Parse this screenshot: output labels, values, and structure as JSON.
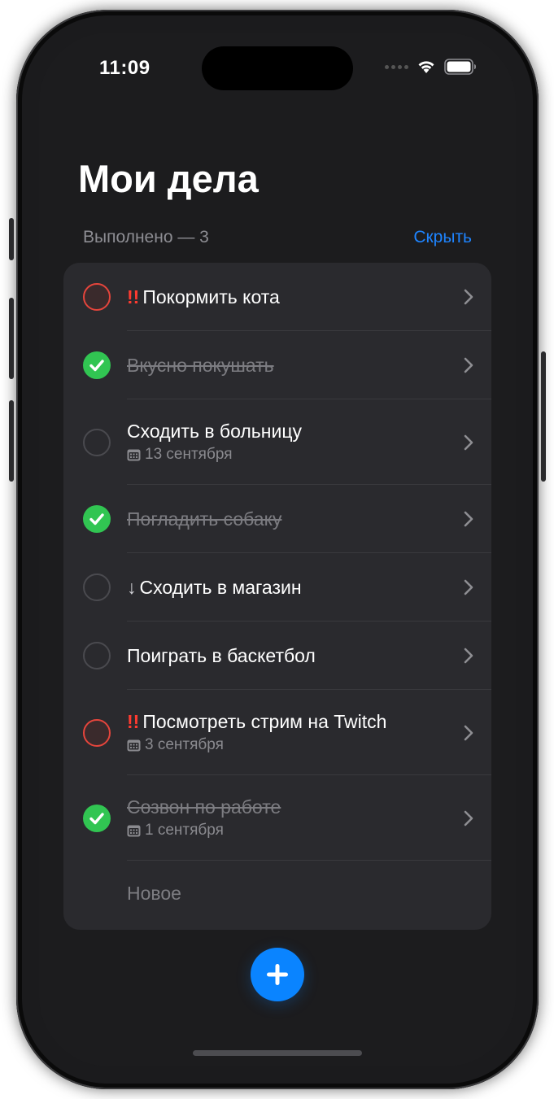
{
  "status_bar": {
    "time": "11:09"
  },
  "header": {
    "title": "Мои дела"
  },
  "summary": {
    "done_label": "Выполнено — 3",
    "hide_label": "Скрыть"
  },
  "tasks": [
    {
      "title": "Покормить кота",
      "prefix": "!!",
      "state": "urgent",
      "date": null
    },
    {
      "title": "Вкусно покушать",
      "prefix": null,
      "state": "done",
      "date": null
    },
    {
      "title": "Сходить в больницу",
      "prefix": null,
      "state": "open",
      "date": "13 сентября"
    },
    {
      "title": "Погладить собаку",
      "prefix": null,
      "state": "done",
      "date": null
    },
    {
      "title": "Сходить в магазин",
      "prefix": "↓",
      "state": "open",
      "date": null
    },
    {
      "title": "Поиграть в баскетбол",
      "prefix": null,
      "state": "open",
      "date": null
    },
    {
      "title": "Посмотреть стрим на Twitch",
      "prefix": "!!",
      "state": "urgent",
      "date": "3 сентября"
    },
    {
      "title": "Созвон по работе",
      "prefix": null,
      "state": "done",
      "date": "1 сентября"
    }
  ],
  "new_item": {
    "placeholder": "Новое"
  },
  "icons": {
    "wifi": "wifi-icon",
    "battery": "battery-icon",
    "chevron": "chevron-right-icon",
    "calendar": "calendar-icon",
    "add": "plus-icon"
  },
  "colors": {
    "accent": "#0a84ff",
    "done": "#31c552",
    "urgent": "#ff3b30",
    "background": "#1c1c1e",
    "card": "#2a2a2e"
  }
}
